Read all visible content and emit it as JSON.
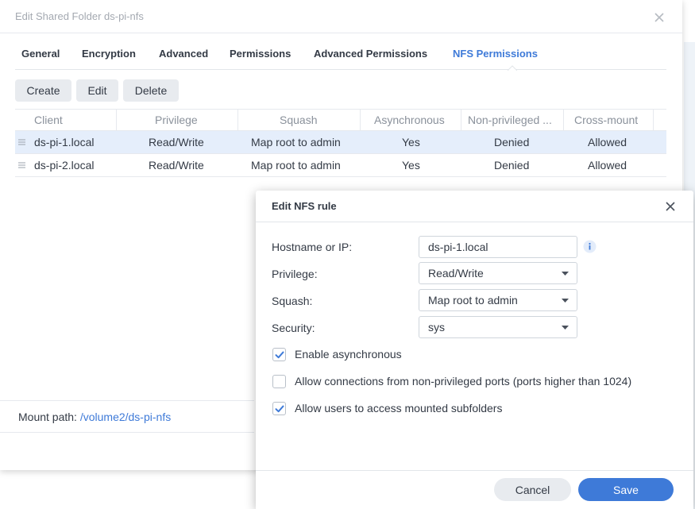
{
  "main_dialog": {
    "title": "Edit Shared Folder ds-pi-nfs",
    "tabs": [
      {
        "label": "General",
        "active": false
      },
      {
        "label": "Encryption",
        "active": false
      },
      {
        "label": "Advanced",
        "active": false
      },
      {
        "label": "Permissions",
        "active": false
      },
      {
        "label": "Advanced Permissions",
        "active": false
      },
      {
        "label": "NFS Permissions",
        "active": true
      }
    ],
    "toolbar": {
      "create_label": "Create",
      "edit_label": "Edit",
      "delete_label": "Delete"
    },
    "table": {
      "columns": [
        "Client",
        "Privilege",
        "Squash",
        "Asynchronous",
        "Non-privileged ...",
        "Cross-mount"
      ],
      "rows": [
        {
          "client": "ds-pi-1.local",
          "privilege": "Read/Write",
          "squash": "Map root to admin",
          "asynchronous": "Yes",
          "non_privileged": "Denied",
          "cross_mount": "Allowed",
          "selected": true
        },
        {
          "client": "ds-pi-2.local",
          "privilege": "Read/Write",
          "squash": "Map root to admin",
          "asynchronous": "Yes",
          "non_privileged": "Denied",
          "cross_mount": "Allowed",
          "selected": false
        }
      ]
    },
    "mount_path_label": "Mount path:",
    "mount_path_value": "/volume2/ds-pi-nfs"
  },
  "nfs_dialog": {
    "title": "Edit NFS rule",
    "hostname_label": "Hostname or IP:",
    "hostname_value": "ds-pi-1.local",
    "privilege_label": "Privilege:",
    "privilege_value": "Read/Write",
    "squash_label": "Squash:",
    "squash_value": "Map root to admin",
    "security_label": "Security:",
    "security_value": "sys",
    "checkboxes": [
      {
        "label": "Enable asynchronous",
        "checked": true
      },
      {
        "label": "Allow connections from non-privileged ports (ports higher than 1024)",
        "checked": false
      },
      {
        "label": "Allow users to access mounted subfolders",
        "checked": true
      }
    ],
    "cancel_label": "Cancel",
    "save_label": "Save"
  },
  "colors": {
    "accent": "#3e7ad8",
    "selected_row": "#e5eefb",
    "button_gray": "#e8ebef",
    "text": "#333a45",
    "muted_text": "#a4a9b1"
  },
  "icons": {
    "close": "close-icon",
    "info": "info-icon",
    "dropdown": "chevron-down-icon",
    "check": "checkmark-icon",
    "drag": "drag-handle-icon"
  }
}
